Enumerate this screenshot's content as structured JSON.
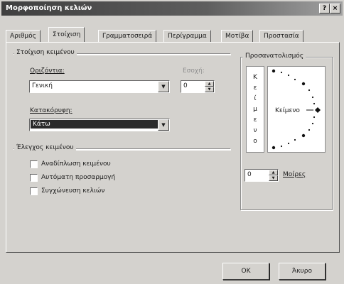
{
  "window": {
    "title": "Μορφοποίηση κελιών",
    "help_btn": "?",
    "close_btn": "×"
  },
  "tabs": [
    {
      "label": "Αριθμός"
    },
    {
      "label": "Στοίχιση",
      "active": true
    },
    {
      "label": "Γραμματοσειρά"
    },
    {
      "label": "Περίγραμμα"
    },
    {
      "label": "Μοτίβα"
    },
    {
      "label": "Προστασία"
    }
  ],
  "alignment": {
    "group_title": "Στοίχιση κειμένου",
    "horizontal_label": "Οριζόντια:",
    "horizontal_value": "Γενική",
    "indent_label": "Εσοχή:",
    "indent_value": "0",
    "vertical_label": "Κατακόρυφη:",
    "vertical_value": "Κάτω"
  },
  "text_control": {
    "group_title": "Έλεγχος κειμένου",
    "wrap_text": "Αναδίπλωση κειμένου",
    "shrink_to_fit": "Αυτόματη προσαρμογή",
    "merge_cells": "Συγχώνευση κελιών"
  },
  "orientation": {
    "group_title": "Προσανατολισμός",
    "vertical_text": [
      "Κ",
      "ε",
      "ί",
      "μ",
      "ε",
      "ν",
      "ο"
    ],
    "dial_text": "Κείμενο",
    "degrees_value": "0",
    "degrees_label": "Μοίρες"
  },
  "footer": {
    "ok": "OK",
    "cancel": "Άκυρο"
  }
}
